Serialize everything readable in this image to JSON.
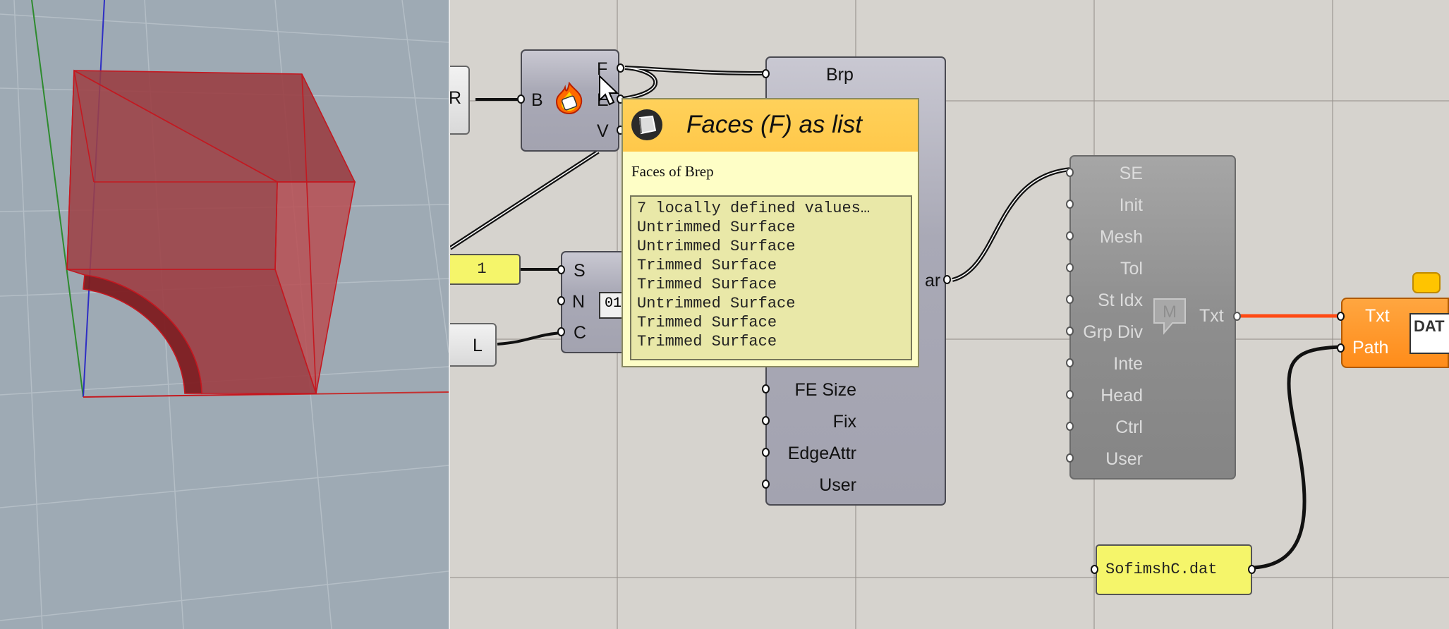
{
  "viewport": {
    "colors": {
      "background": "#9eaab4",
      "solid_fill": "#9a3b40",
      "solid_edge": "#c41820",
      "x_axis": "#c43030",
      "y_axis": "#2e8b2e",
      "z_axis": "#2e2ec4"
    }
  },
  "canvas": {
    "colors": {
      "background": "#d6d3ce",
      "wire": "#111111",
      "selected_wire": "#ff4a14",
      "panel": "#f5f56a",
      "dat_component": "#ff941f"
    },
    "deconstruct_brep": {
      "input_label": "B",
      "outputs": [
        "F",
        "E",
        "V"
      ],
      "icon": "deconstruct-brep-flame-icon"
    },
    "left_param_label": "R",
    "number_panel_value": "1",
    "series_component": {
      "inputs": [
        "S",
        "N",
        "C"
      ],
      "icon": "series-01-icon"
    },
    "length_param_label": "L",
    "sofimsh_component": {
      "top_label": "Brp",
      "partial_output": "ar",
      "inputs_bottom": [
        "FE Size",
        "Fix",
        "EdgeAttr",
        "User"
      ]
    },
    "mesh_component": {
      "inputs": [
        "SE",
        "Init",
        "Mesh",
        "Tol",
        "St Idx",
        "Grp Div",
        "Inte",
        "Head",
        "Ctrl",
        "User"
      ],
      "output": "Txt",
      "icon": "mesh-m-icon"
    },
    "filename_panel": "SofimshC.dat",
    "dat_component": {
      "inputs": [
        "Txt",
        "Path"
      ],
      "icon_text": "DAT"
    },
    "tooltip": {
      "title": "Faces (F) as list",
      "description": "Faces of Brep",
      "values": [
        "7 locally defined values…",
        "Untrimmed Surface",
        "Untrimmed Surface",
        "Trimmed Surface",
        "Trimmed Surface",
        "Untrimmed Surface",
        "Trimmed Surface",
        "Trimmed Surface"
      ],
      "icon": "surface-param-icon"
    }
  }
}
